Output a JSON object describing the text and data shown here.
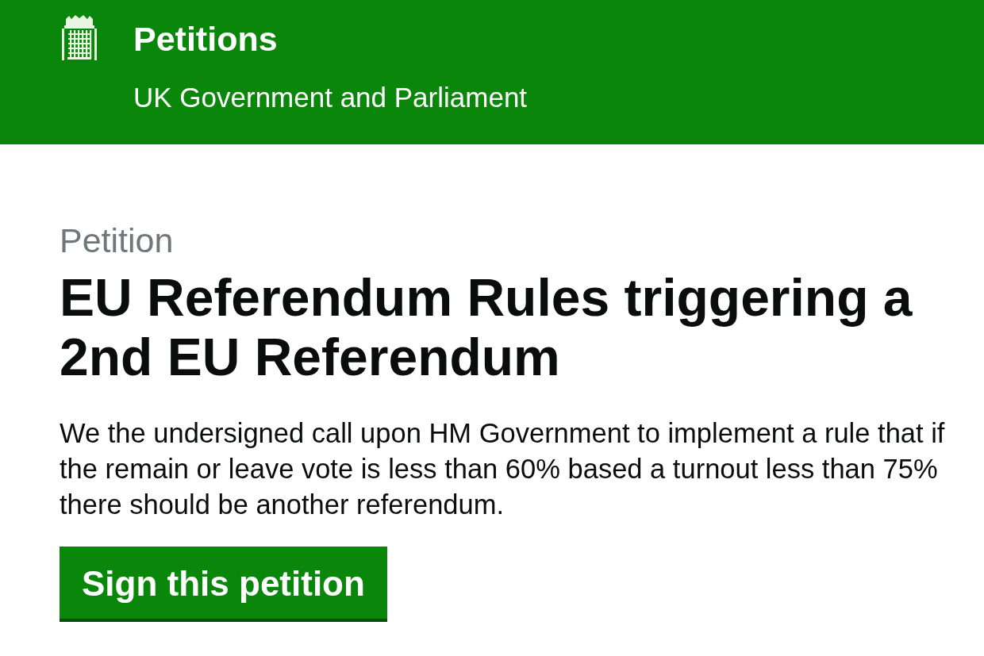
{
  "header": {
    "title": "Petitions",
    "subtitle": "UK Government and Parliament"
  },
  "petition": {
    "label": "Petition",
    "title": "EU Referendum Rules triggering a 2nd EU Referendum",
    "description": "We the undersigned call upon HM Government to implement a rule that if the remain or leave vote is less than 60% based a turnout less than 75% there should be another referendum.",
    "button": "Sign this petition"
  }
}
